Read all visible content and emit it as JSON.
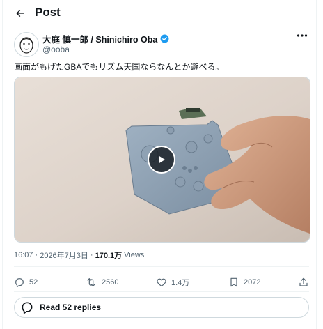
{
  "header": {
    "title": "Post"
  },
  "author": {
    "name": "大庭 慎一郎 / Shinichiro Oba",
    "handle": "@ooba"
  },
  "tweet": {
    "text": "画面がもげたGBAでもリズム天国ならなんとか遊べる。"
  },
  "meta": {
    "time": "16:07",
    "separator": "·",
    "date": "2026年7月3日",
    "views_count": "170.1万",
    "views_label": "Views"
  },
  "actions": {
    "replies": "52",
    "reposts": "2560",
    "likes": "1.4万",
    "bookmarks": "2072"
  },
  "read_replies": {
    "label": "Read 52 replies"
  },
  "colors": {
    "accent": "#1d9bf0",
    "secondary_text": "#536471",
    "border": "#cfd9de"
  }
}
